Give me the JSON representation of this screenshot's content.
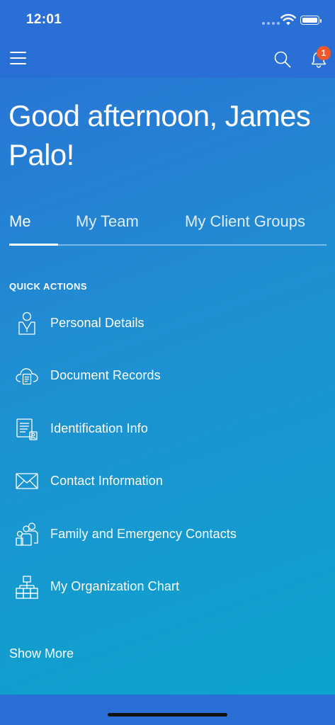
{
  "status_bar": {
    "time": "12:01"
  },
  "nav": {
    "menu_icon": "hamburger-icon",
    "search_icon": "search-icon",
    "notifications_icon": "bell-icon",
    "notification_count": "1"
  },
  "greeting": "Good afternoon, James Palo!",
  "tabs": [
    {
      "label": "Me",
      "active": true
    },
    {
      "label": "My Team",
      "active": false
    },
    {
      "label": "My Client Groups",
      "active": false
    }
  ],
  "quick_actions": {
    "heading": "QUICK ACTIONS",
    "items": [
      {
        "label": "Personal Details",
        "icon": "person-icon"
      },
      {
        "label": "Document Records",
        "icon": "cloud-document-icon"
      },
      {
        "label": "Identification Info",
        "icon": "id-document-icon"
      },
      {
        "label": "Contact Information",
        "icon": "envelope-icon"
      },
      {
        "label": "Family and Emergency Contacts",
        "icon": "family-icon"
      },
      {
        "label": "My Organization Chart",
        "icon": "org-chart-icon"
      }
    ],
    "show_more": "Show More"
  },
  "colors": {
    "topbar": "#2a6fd6",
    "gradient_start": "#2c6fd6",
    "gradient_end": "#0aa6cc",
    "badge": "#f1592a"
  }
}
